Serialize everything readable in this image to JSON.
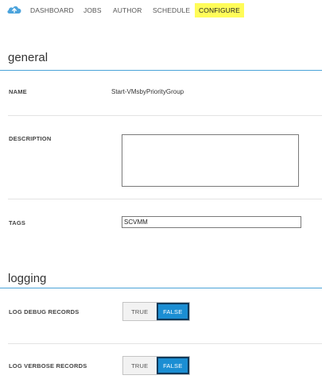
{
  "nav": {
    "icon": "cloud-icon",
    "tabs": [
      {
        "label": "DASHBOARD"
      },
      {
        "label": "JOBS"
      },
      {
        "label": "AUTHOR"
      },
      {
        "label": "SCHEDULE"
      },
      {
        "label": "CONFIGURE",
        "active": true
      }
    ]
  },
  "general": {
    "title": "general",
    "name_label": "NAME",
    "name_value": "Start-VMsbyPriorityGroup",
    "description_label": "DESCRIPTION",
    "description_value": "",
    "tags_label": "TAGS",
    "tags_value": "SCVMM"
  },
  "logging": {
    "title": "logging",
    "debug_label": "LOG DEBUG RECORDS",
    "verbose_label": "LOG VERBOSE RECORDS",
    "true_label": "TRUE",
    "false_label": "FALSE",
    "debug_value": "FALSE",
    "verbose_value": "FALSE"
  },
  "colors": {
    "accent": "#1b8ed3",
    "active_tab_highlight": "#fffc58",
    "section_rule": "#4aa3d8"
  }
}
